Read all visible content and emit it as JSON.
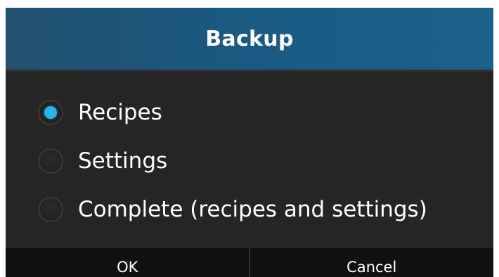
{
  "dialog": {
    "title": "Backup",
    "options": [
      {
        "label": "Recipes",
        "selected": true
      },
      {
        "label": "Settings",
        "selected": false
      },
      {
        "label": "Complete (recipes and settings)",
        "selected": false
      }
    ],
    "buttons": {
      "ok_label": "OK",
      "cancel_label": "Cancel"
    }
  },
  "colors": {
    "header_bg": "#1a5a82",
    "dialog_bg": "#252526",
    "footer_bg": "#111111",
    "accent": "#27b6ea",
    "text": "#ffffff"
  }
}
